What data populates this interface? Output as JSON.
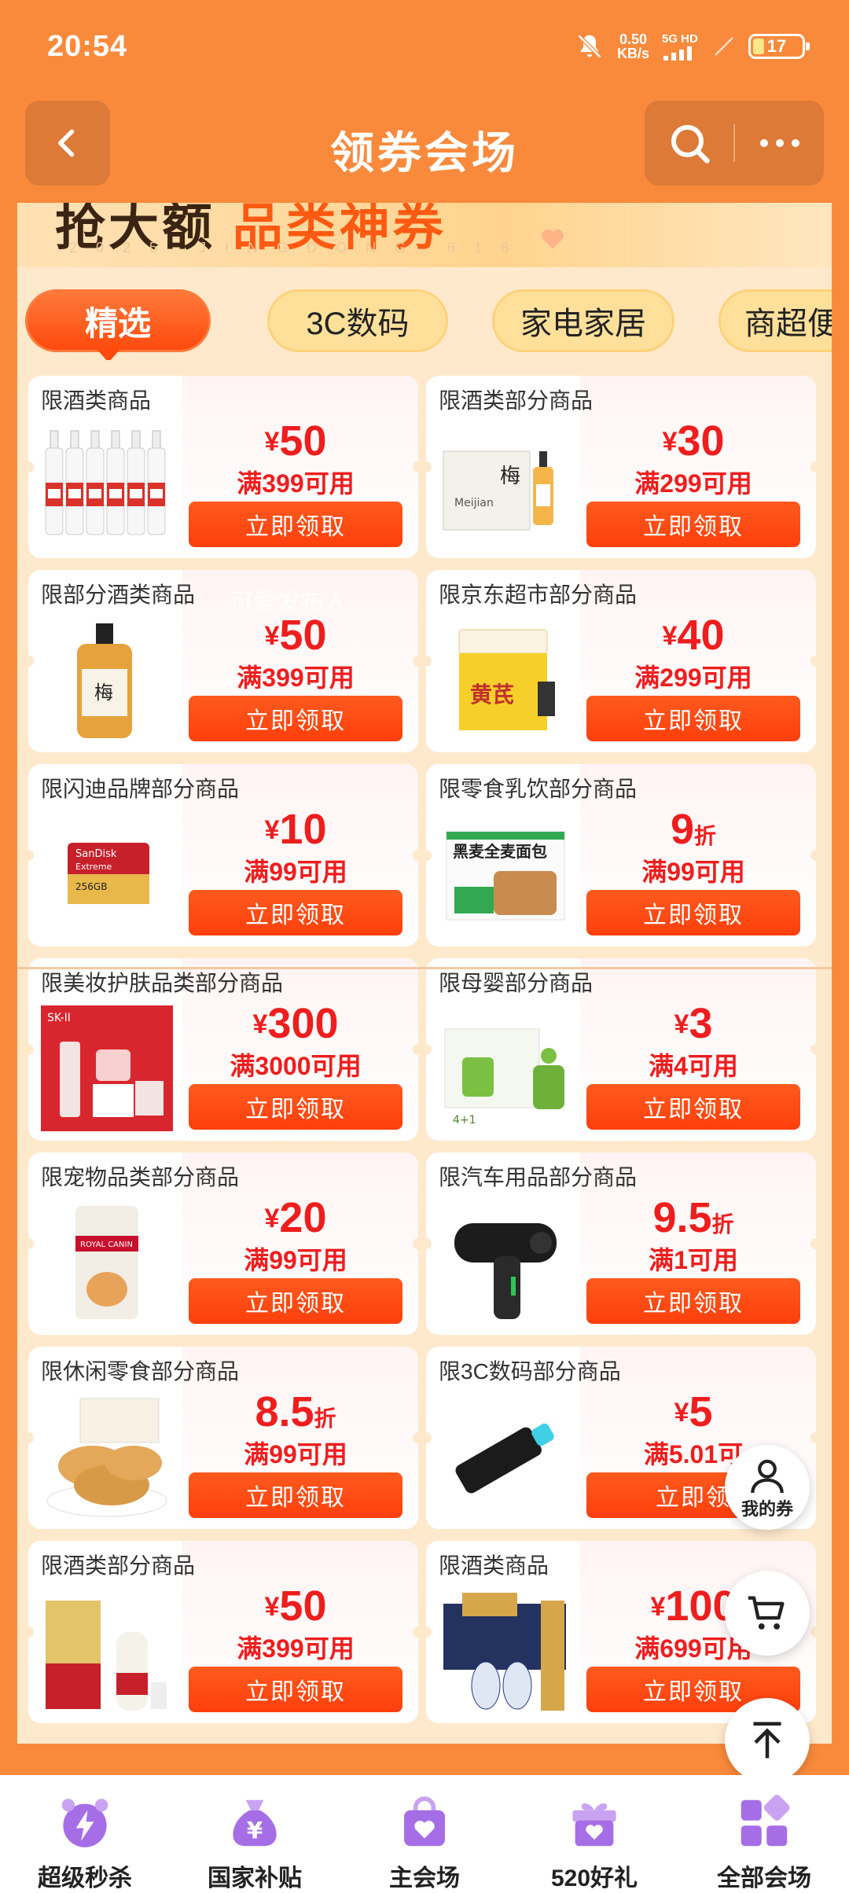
{
  "status_bar": {
    "time": "20:54",
    "net_speed_value": "0.50",
    "net_speed_unit": "KB/s",
    "network": "5G HD",
    "battery": "17"
  },
  "header": {
    "title": "领券会场"
  },
  "banner": {
    "title_dark": "抢大额",
    "title_highlight": "品类神券",
    "subtitle": "2025 JINGDONG 618"
  },
  "tabs": [
    {
      "label": "精选",
      "active": true
    },
    {
      "label": "3C数码",
      "active": false
    },
    {
      "label": "家电家居",
      "active": false
    },
    {
      "label": "商超便",
      "active": false
    }
  ],
  "watermark": "可爱发布人",
  "coupons": [
    {
      "title": "限酒类商品",
      "currency": "¥",
      "value": "50",
      "unit": "",
      "condition": "满399可用",
      "button": "立即领取",
      "image": "baijiu-bottles"
    },
    {
      "title": "限酒类部分商品",
      "currency": "¥",
      "value": "30",
      "unit": "",
      "condition": "满299可用",
      "button": "立即领取",
      "image": "meijian-giftbox"
    },
    {
      "title": "限部分酒类商品",
      "currency": "¥",
      "value": "50",
      "unit": "",
      "condition": "满399可用",
      "button": "立即领取",
      "image": "meijian-bottle"
    },
    {
      "title": "限京东超市部分商品",
      "currency": "¥",
      "value": "40",
      "unit": "",
      "condition": "满299可用",
      "button": "立即领取",
      "image": "huangqi-tea"
    },
    {
      "title": "限闪迪品牌部分商品",
      "currency": "¥",
      "value": "10",
      "unit": "",
      "condition": "满99可用",
      "button": "立即领取",
      "image": "sandisk-card"
    },
    {
      "title": "限零食乳饮部分商品",
      "currency": "",
      "value": "9",
      "unit": "折",
      "condition": "满99可用",
      "button": "立即领取",
      "image": "bread-box"
    },
    {
      "title": "限美妆护肤品类部分商品",
      "currency": "¥",
      "value": "300",
      "unit": "",
      "condition": "满3000可用",
      "button": "立即领取",
      "image": "skii-giftset"
    },
    {
      "title": "限母婴部分商品",
      "currency": "¥",
      "value": "3",
      "unit": "",
      "condition": "满4可用",
      "button": "立即领取",
      "image": "mosquito-repellent"
    },
    {
      "title": "限宠物品类部分商品",
      "currency": "¥",
      "value": "20",
      "unit": "",
      "condition": "满99可用",
      "button": "立即领取",
      "image": "royal-canin-bag"
    },
    {
      "title": "限汽车用品部分商品",
      "currency": "",
      "value": "9.5",
      "unit": "折",
      "condition": "满1可用",
      "button": "立即领取",
      "image": "handheld-blower"
    },
    {
      "title": "限休闲零食部分商品",
      "currency": "",
      "value": "8.5",
      "unit": "折",
      "condition": "满99可用",
      "button": "立即领取",
      "image": "pastry-cakes"
    },
    {
      "title": "限3C数码部分商品",
      "currency": "¥",
      "value": "5",
      "unit": "",
      "condition": "满5.01可",
      "button": "立即领",
      "image": "usb-drive"
    },
    {
      "title": "限酒类部分商品",
      "currency": "¥",
      "value": "50",
      "unit": "",
      "condition": "满399可用",
      "button": "立即领取",
      "image": "moutai-box"
    },
    {
      "title": "限酒类商品",
      "currency": "¥",
      "value": "100",
      "unit": "",
      "condition": "满699可用",
      "button": "立即领取",
      "image": "liquor-giftbox"
    }
  ],
  "floating": {
    "my_coupons": "我的券"
  },
  "bottom_nav": [
    {
      "label": "超级秒杀",
      "icon": "alarm-lightning-icon"
    },
    {
      "label": "国家补贴",
      "icon": "money-bag-icon"
    },
    {
      "label": "主会场",
      "icon": "shopping-bag-heart-icon"
    },
    {
      "label": "520好礼",
      "icon": "gift-heart-icon"
    },
    {
      "label": "全部会场",
      "icon": "grid-apps-icon"
    }
  ],
  "colors": {
    "header_bg": "#f98a3c",
    "content_bg": "#ffe9cd",
    "accent_red": "#ee1e1e",
    "button_orange": "#ff4a0e",
    "nav_purple": "#a66ee6"
  }
}
